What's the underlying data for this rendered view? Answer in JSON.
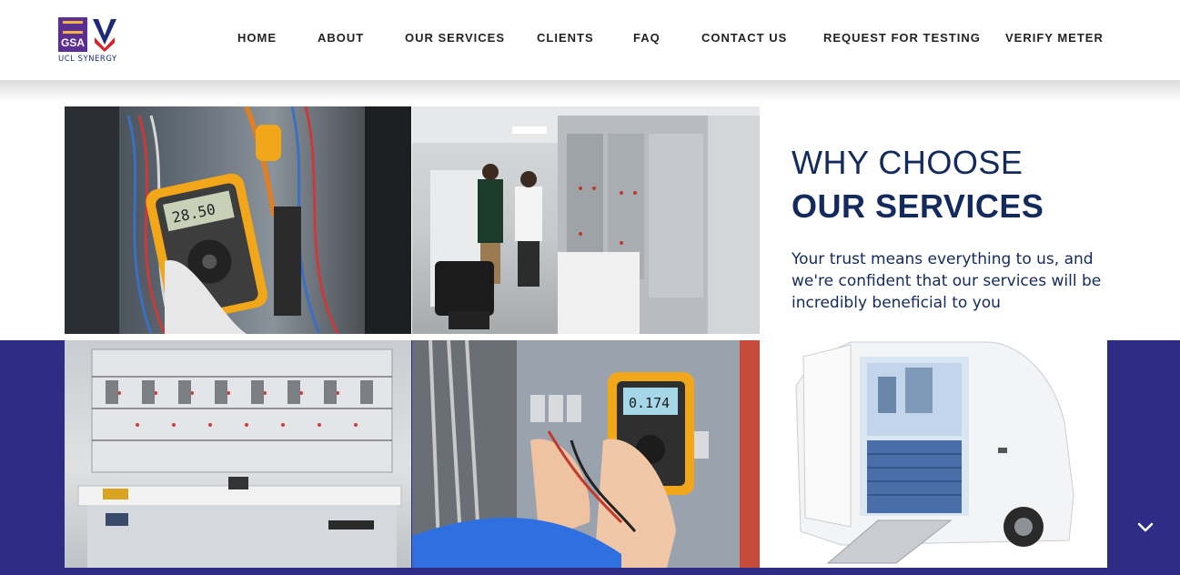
{
  "header": {
    "logo_text": "UCL SYNERGY",
    "logo_badge": "GSA",
    "nav": [
      {
        "label": "HOME"
      },
      {
        "label": "ABOUT"
      },
      {
        "label": "OUR SERVICES"
      },
      {
        "label": "CLIENTS"
      },
      {
        "label": "FAQ"
      },
      {
        "label": "CONTACT US"
      },
      {
        "label": "REQUEST FOR TESTING"
      },
      {
        "label": "VERIFY METER"
      }
    ]
  },
  "main": {
    "heading_line1": "WHY CHOOSE",
    "heading_line2": "OUR SERVICES",
    "description": "Your trust means everything to us, and we're confident that our services will be incredibly beneficial to you",
    "photos": [
      {
        "meter_reading": "28.50"
      },
      {},
      {},
      {
        "meter_reading": "0.174"
      },
      {}
    ]
  },
  "colors": {
    "brand_navy": "#132a5c",
    "band": "#2e2d85",
    "logo_purple": "#5b2e91",
    "logo_red": "#d8232a"
  },
  "icons": {
    "scroll": "chevron-down-icon"
  }
}
